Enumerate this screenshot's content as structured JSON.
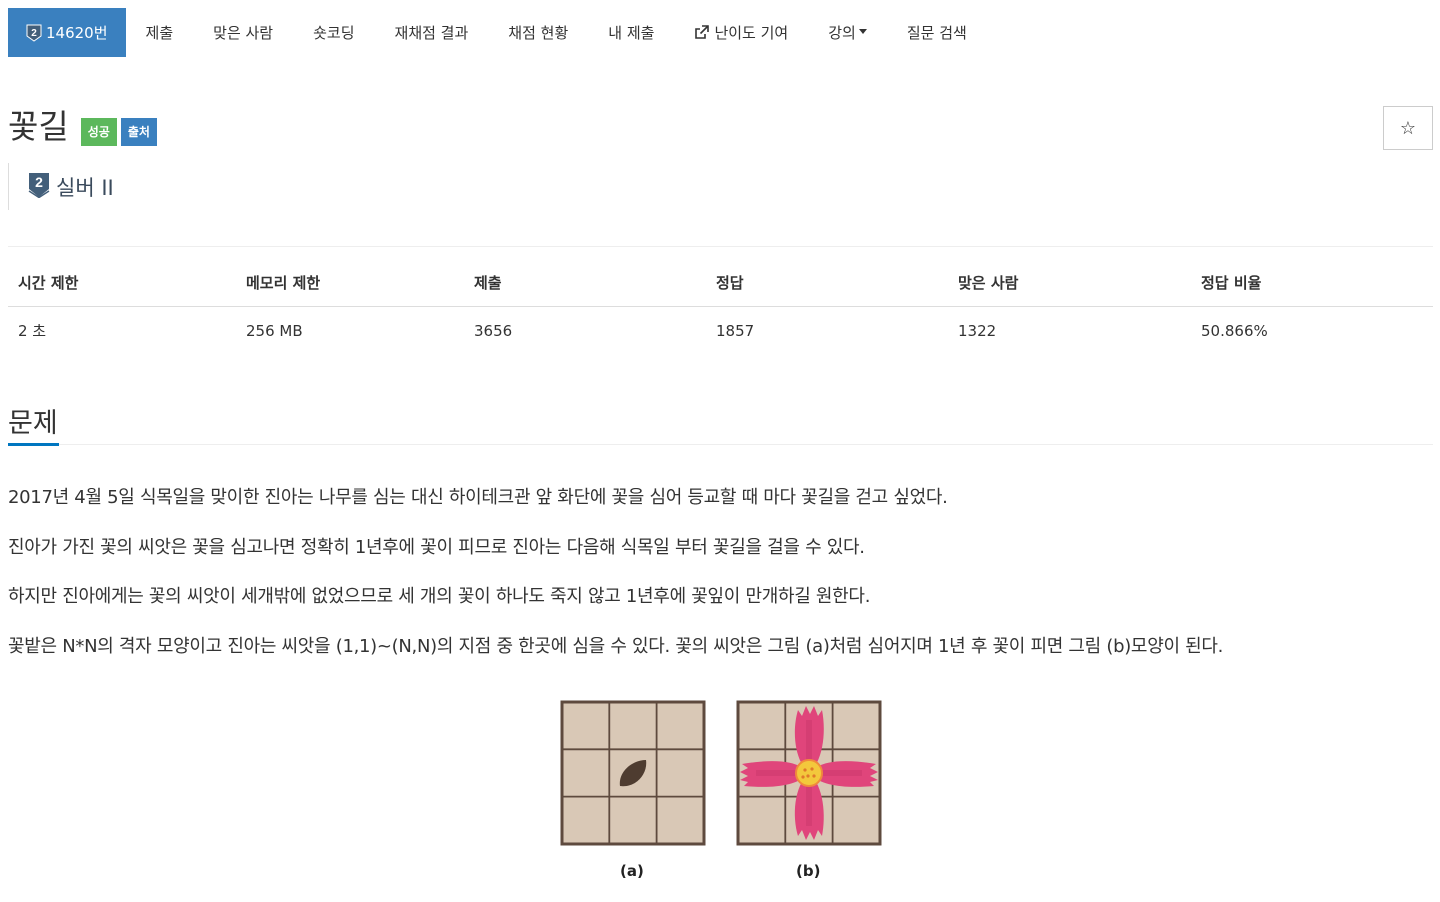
{
  "nav": {
    "problem_number": "14620번",
    "items": [
      "제출",
      "맞은 사람",
      "숏코딩",
      "재채점 결과",
      "채점 현황",
      "내 제출"
    ],
    "difficulty": "난이도 기여",
    "lecture": "강의",
    "question_search": "질문 검색"
  },
  "problem": {
    "title": "꽃길",
    "badges": [
      "성공",
      "출처"
    ],
    "tier_label": "실버 II",
    "tier_level": "2",
    "star_icon": "☆"
  },
  "stats": {
    "headers": [
      "시간 제한",
      "메모리 제한",
      "제출",
      "정답",
      "맞은 사람",
      "정답 비율"
    ],
    "values": [
      "2 초",
      "256 MB",
      "3656",
      "1857",
      "1322",
      "50.866%"
    ]
  },
  "section": {
    "title": "문제"
  },
  "description": [
    "2017년 4월 5일 식목일을 맞이한 진아는 나무를 심는 대신 하이테크관 앞 화단에 꽃을 심어 등교할 때 마다 꽃길을 걷고 싶었다.",
    "진아가 가진 꽃의 씨앗은 꽃을 심고나면 정확히 1년후에 꽃이 피므로 진아는 다음해 식목일 부터 꽃길을 걸을 수 있다.",
    "하지만 진아에게는 꽃의 씨앗이 세개밖에 없었으므로 세 개의 꽃이 하나도 죽지 않고 1년후에 꽃잎이 만개하길 원한다.",
    "꽃밭은 N*N의 격자 모양이고 진아는 씨앗을 (1,1)~(N,N)의 지점 중 한곳에 심을 수 있다. 꽃의 씨앗은 그림 (a)처럼 심어지며 1년 후 꽃이 피면 그림 (b)모양이 된다."
  ],
  "figure": {
    "caption_a": "(a)",
    "caption_b": "(b)"
  },
  "colors": {
    "accent": "#3a80bf",
    "success": "#5cb85c",
    "section_underline": "#0076c0",
    "grid_fill": "#d9c8b6",
    "grid_line": "#5e4a3e",
    "petal": "#e0457b",
    "flower_center": "#f3c83c",
    "seed": "#4e3c30"
  }
}
